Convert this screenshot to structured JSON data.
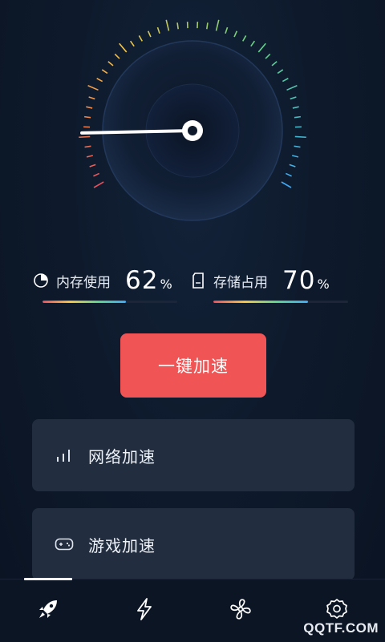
{
  "gauge": {
    "needle_level": 0.12
  },
  "stats": {
    "memory": {
      "label": "内存使用",
      "value": "62",
      "unit": "%",
      "level": 0.62
    },
    "storage": {
      "label": "存储占用",
      "value": "70",
      "unit": "%",
      "level": 0.7
    }
  },
  "boost_button": {
    "label": "一键加速"
  },
  "cards": [
    {
      "label": "网络加速",
      "icon": "signal-bars-icon"
    },
    {
      "label": "游戏加速",
      "icon": "gamepad-icon"
    }
  ],
  "tabs": [
    {
      "icon": "rocket-icon",
      "active": true
    },
    {
      "icon": "lightning-icon",
      "active": false
    },
    {
      "icon": "fan-icon",
      "active": false
    },
    {
      "icon": "gear-icon",
      "active": false
    }
  ],
  "watermark": "QQTF.COM",
  "colors": {
    "accent": "#f05454",
    "card": "#222e3f",
    "background": "#0e1a2c"
  }
}
